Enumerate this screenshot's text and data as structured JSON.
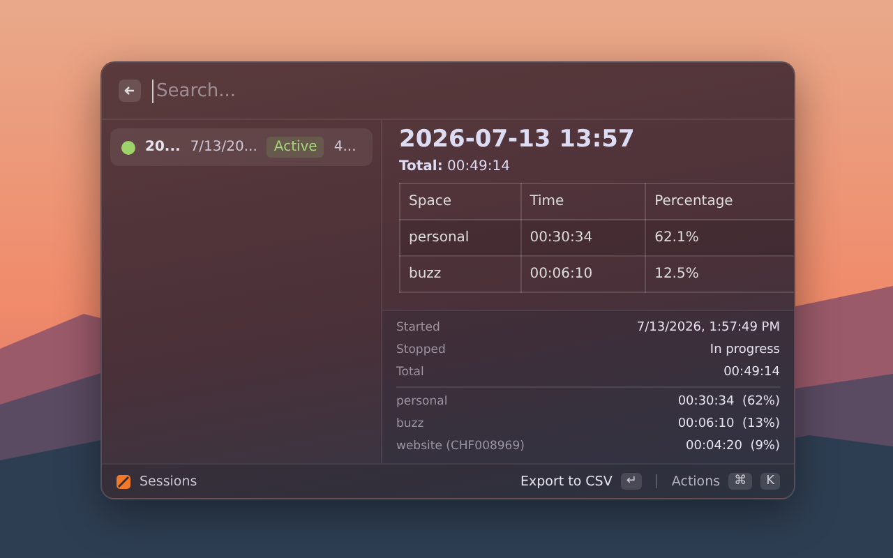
{
  "search": {
    "placeholder": "Search..."
  },
  "sessions": [
    {
      "name": "20...",
      "date": "7/13/20...",
      "status": "Active",
      "duration": "4...",
      "color": "#9ed36a",
      "selected": true
    }
  ],
  "detail": {
    "title": "2026-07-13 13:57",
    "total_label": "Total:",
    "total_value": "00:49:14",
    "table": {
      "columns": [
        "Space",
        "Time",
        "Percentage"
      ],
      "rows": [
        [
          "personal",
          "00:30:34",
          "62.1%"
        ],
        [
          "buzz",
          "00:06:10",
          "12.5%"
        ]
      ]
    }
  },
  "metadata": {
    "fields": [
      {
        "label": "Started",
        "value": "7/13/2026, 1:57:49 PM"
      },
      {
        "label": "Stopped",
        "value": "In progress"
      },
      {
        "label": "Total",
        "value": "00:49:14"
      }
    ],
    "spaces": [
      {
        "label": "personal",
        "value": "00:30:34  (62%)"
      },
      {
        "label": "buzz",
        "value": "00:06:10  (13%)"
      },
      {
        "label": "website (CHF008969)",
        "value": "00:04:20  (9%)"
      }
    ]
  },
  "footer": {
    "title": "Sessions",
    "primary_action": "Export to CSV",
    "primary_key": "↵",
    "actions_label": "Actions",
    "action_keys": [
      "⌘",
      "K"
    ]
  }
}
